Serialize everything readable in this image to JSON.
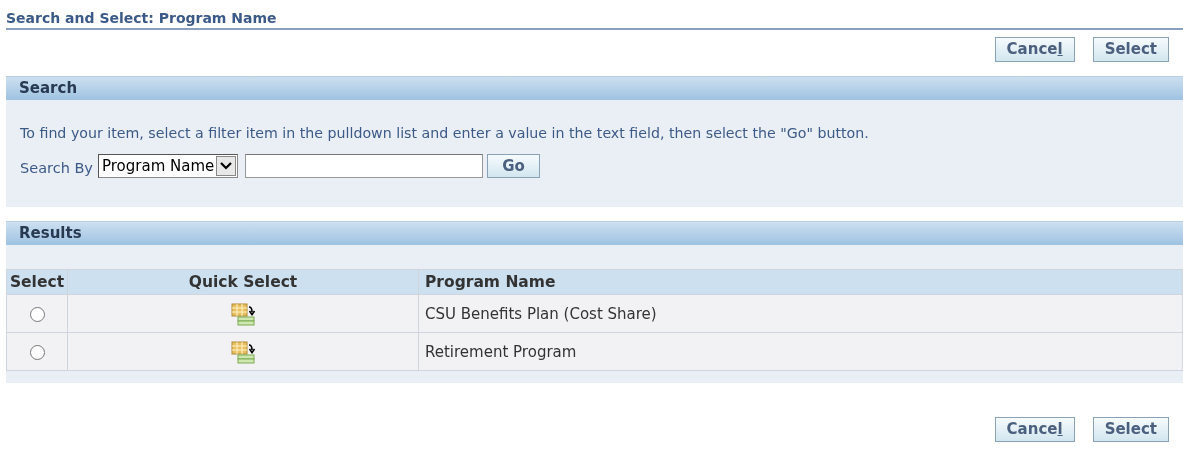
{
  "page_title": "Search and Select: Program Name",
  "top_buttons": [
    {
      "label": "Cance",
      "access_key": "l"
    },
    {
      "label": "Select"
    }
  ],
  "search": {
    "header": "Search",
    "instructions": "To find your item, select a filter item in the pulldown list and enter a value in the text field, then select the \"Go\" button.",
    "search_by_label": "Search By",
    "filter": {
      "value": "Program Name"
    },
    "go_button": "Go"
  },
  "results": {
    "header": "Results",
    "columns": [
      "Select",
      "Quick Select",
      "Program Name"
    ],
    "rows": [
      {
        "selected": false,
        "program_name": "CSU Benefits Plan (Cost Share)"
      },
      {
        "selected": false,
        "program_name": "Retirement Program"
      }
    ]
  },
  "bottom_buttons": [
    {
      "label": "Cance",
      "access_key": "l"
    },
    {
      "label": "Select"
    }
  ]
}
